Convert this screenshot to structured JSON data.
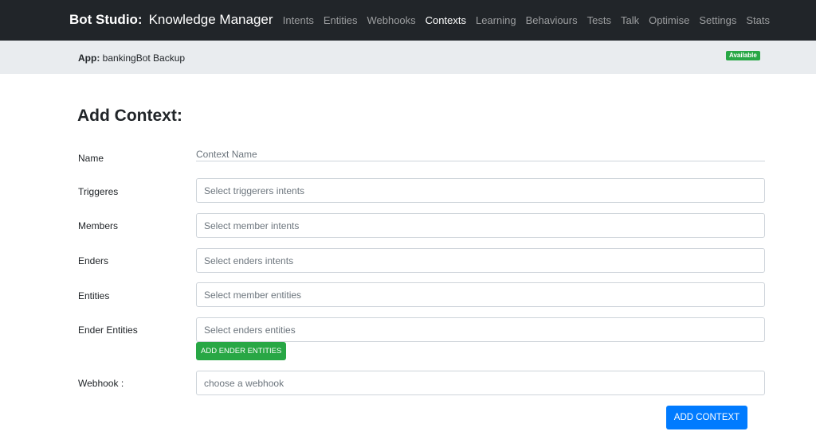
{
  "brand": {
    "name": "Bot Studio:",
    "subtitle": "Knowledge Manager"
  },
  "nav": {
    "items": [
      "Intents",
      "Entities",
      "Webhooks",
      "Contexts",
      "Learning",
      "Behaviours",
      "Tests",
      "Talk",
      "Optimise",
      "Settings",
      "Stats"
    ],
    "active": "Contexts"
  },
  "app": {
    "label": "App:",
    "name": "bankingBot Backup",
    "status": "Available",
    "status_color": "#28a745"
  },
  "page": {
    "title": "Add Context:"
  },
  "form": {
    "name": {
      "label": "Name",
      "placeholder": "Context Name"
    },
    "triggers": {
      "label": "Triggeres",
      "placeholder": "Select triggerers intents"
    },
    "members": {
      "label": "Members",
      "placeholder": "Select member intents"
    },
    "enders": {
      "label": "Enders",
      "placeholder": "Select enders intents"
    },
    "entities": {
      "label": "Entities",
      "placeholder": "Select member entities"
    },
    "ender_entities": {
      "label": "Ender Entities",
      "placeholder": "Select enders entities",
      "add_button": "ADD ENDER ENTITIES"
    },
    "webhook": {
      "label": "Webhook :",
      "placeholder": "choose a webhook"
    },
    "submit": "ADD CONTEXT"
  },
  "colors": {
    "navbar": "#212529",
    "primary": "#007bff",
    "success": "#28a745",
    "subbar": "#e9ecef"
  }
}
